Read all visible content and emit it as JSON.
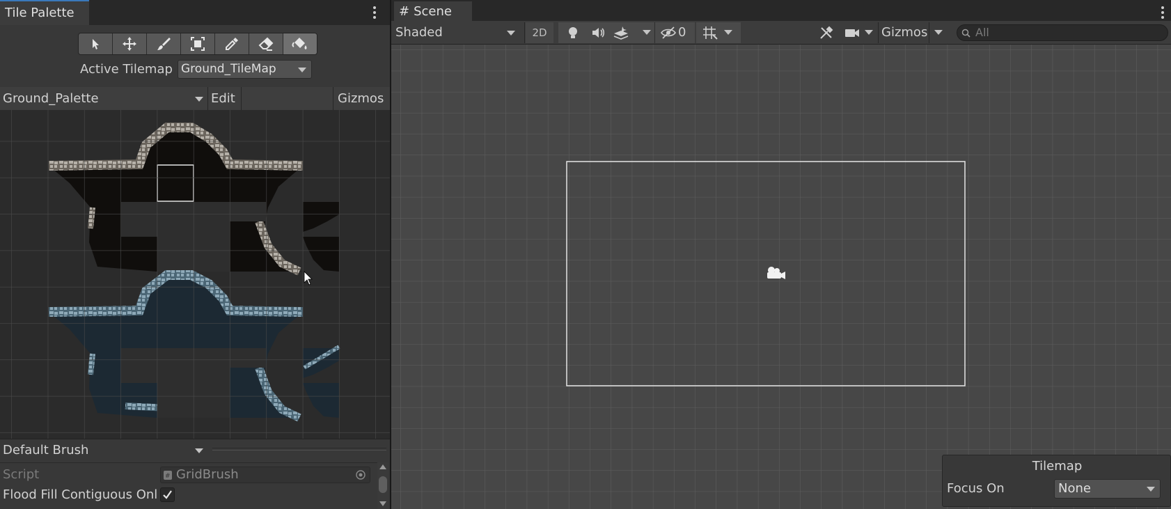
{
  "tile_palette": {
    "tab_title": "Tile Palette",
    "tools": [
      {
        "name": "select-tool",
        "icon": "arrow-pointer-icon"
      },
      {
        "name": "move-tool",
        "icon": "move-arrows-icon"
      },
      {
        "name": "paint-tool",
        "icon": "brush-icon"
      },
      {
        "name": "box-fill-tool",
        "icon": "box-fill-icon"
      },
      {
        "name": "pick-tool",
        "icon": "eyedropper-icon"
      },
      {
        "name": "erase-tool",
        "icon": "eraser-icon"
      },
      {
        "name": "flood-fill-tool",
        "icon": "paint-bucket-icon",
        "active": true
      }
    ],
    "active_tilemap_label": "Active Tilemap",
    "active_tilemap_value": "Ground_TileMap",
    "palette_select": "Ground_Palette",
    "edit_label": "Edit",
    "gizmos_label": "Gizmos",
    "brush_select": "Default Brush",
    "script_label": "Script",
    "script_value": "GridBrush",
    "flood_fill_label": "Flood Fill Contiguous Onl",
    "flood_fill_checked": true
  },
  "scene": {
    "tab_title": "Scene",
    "shading_mode": "Shaded",
    "mode_2d": "2D",
    "hidden_count": "0",
    "gizmos_label": "Gizmos",
    "search_placeholder": "All",
    "overlay_title": "Tilemap",
    "focus_on_label": "Focus On",
    "focus_on_value": "None"
  },
  "colors": {
    "accent_tab": "#3a79bb",
    "cave_dark": "#100e0c",
    "cave_blue": "#1c2933",
    "rock_light": "#a8a39b",
    "rock_blue": "#7b9bad"
  }
}
